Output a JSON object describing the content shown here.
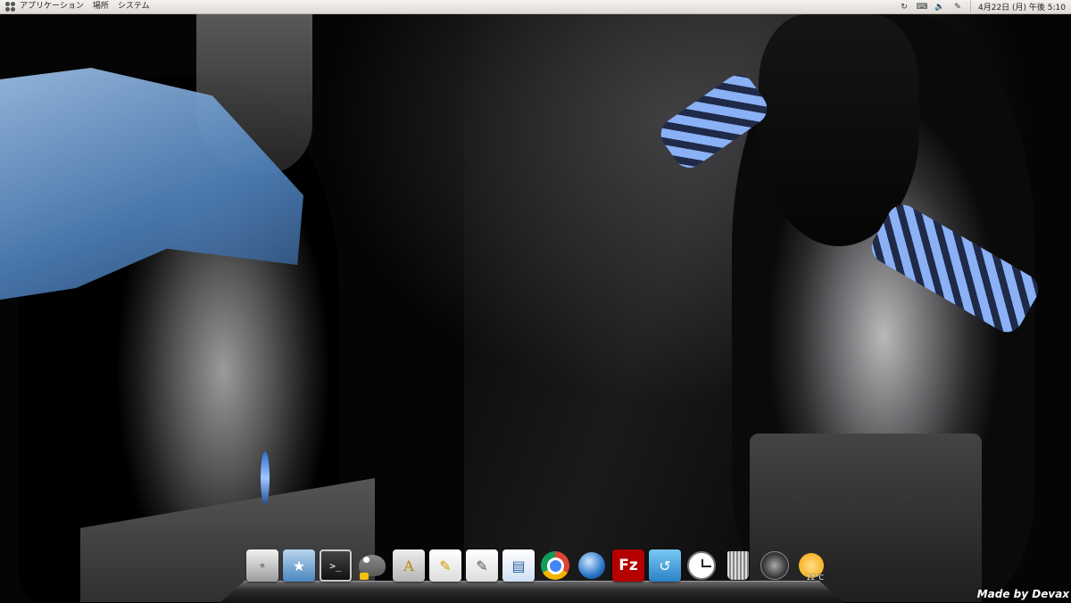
{
  "top_panel": {
    "menus": [
      "アプリケーション",
      "場所",
      "システム"
    ],
    "tray_icons": [
      "update-icon",
      "keyboard-icon",
      "volume-icon",
      "pen-icon"
    ],
    "clock": "4月22日 (月) 午後 5:10"
  },
  "dock": {
    "items": [
      {
        "name": "system-monitor-icon",
        "glyph": "≡"
      },
      {
        "name": "home-folder-icon",
        "glyph": "★"
      },
      {
        "name": "terminal-icon",
        "glyph": ">_"
      },
      {
        "name": "gimp-icon",
        "glyph": ""
      },
      {
        "name": "font-viewer-icon",
        "glyph": "A"
      },
      {
        "name": "text-editor-icon",
        "glyph": "✎"
      },
      {
        "name": "notes-editor-icon",
        "glyph": "✎"
      },
      {
        "name": "writer-document-icon",
        "glyph": "▤"
      },
      {
        "name": "chrome-icon",
        "glyph": ""
      },
      {
        "name": "web-browser-icon",
        "glyph": ""
      },
      {
        "name": "filezilla-icon",
        "glyph": "Fz"
      },
      {
        "name": "swirl-app-icon",
        "glyph": "↺"
      },
      {
        "name": "clock-icon",
        "glyph": ""
      },
      {
        "name": "trash-icon",
        "glyph": ""
      },
      {
        "name": "shutdown-icon",
        "glyph": ""
      },
      {
        "name": "weather-icon",
        "glyph": ""
      }
    ],
    "weather_temp": "12°C"
  },
  "wallpaper": {
    "credit": "Made by Devax"
  },
  "colors": {
    "panel_bg": "#e9e6e0",
    "accent_blue": "#4d7fb8"
  }
}
